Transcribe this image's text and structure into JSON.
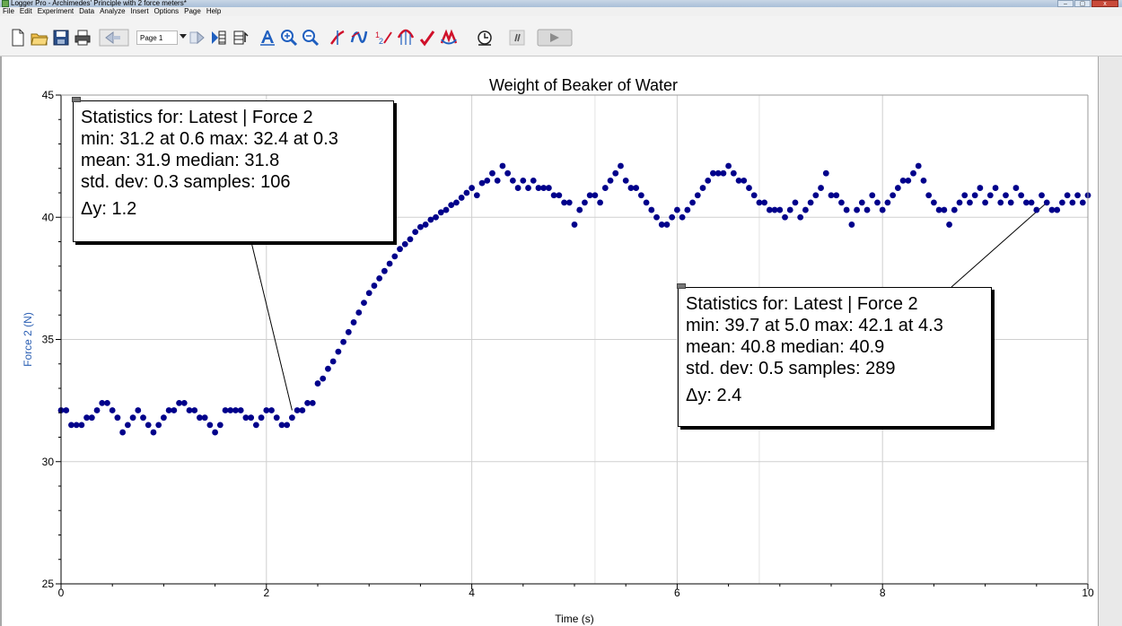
{
  "window": {
    "title": "Logger Pro - Archimedes' Principle with 2 force meters*",
    "buttons": [
      "–",
      "▢",
      "x"
    ]
  },
  "menu": [
    "File",
    "Edit",
    "Experiment",
    "Data",
    "Analyze",
    "Insert",
    "Options",
    "Page",
    "Help"
  ],
  "toolbar": {
    "page_select": "Page 1"
  },
  "colors": {
    "data": "#00008b",
    "accent_blue": "#2b5fb3",
    "red_tool": "#d0102a"
  },
  "icons": [
    "new-file-icon",
    "open-folder-icon",
    "save-icon",
    "print-icon",
    "page-back-icon",
    "page-forward-icon",
    "data-browser-icon",
    "meter-icon",
    "autoscale-icon",
    "zoom-in-icon",
    "zoom-out-icon",
    "examine-icon",
    "tangent-icon",
    "interpolate-icon",
    "statistics-icon",
    "integral-icon",
    "linear-fit-icon",
    "curve-fit-icon",
    "replay-icon",
    "sensor-icon",
    "collect-icon"
  ],
  "chart_data": {
    "type": "scatter",
    "title": "Weight of Beaker of Water",
    "xlabel": "Time (s)",
    "ylabel": "Force 2 (N)",
    "xlim": [
      0,
      10
    ],
    "ylim": [
      25,
      45
    ],
    "x_ticks": [
      0,
      2,
      4,
      6,
      8,
      10
    ],
    "y_ticks": [
      25,
      30,
      35,
      40,
      45
    ],
    "grid": true,
    "series": [
      {
        "points": [
          [
            0.0,
            32.1
          ],
          [
            0.05,
            32.1
          ],
          [
            0.1,
            31.5
          ],
          [
            0.15,
            31.5
          ],
          [
            0.2,
            31.5
          ],
          [
            0.25,
            31.8
          ],
          [
            0.3,
            31.8
          ],
          [
            0.35,
            32.1
          ],
          [
            0.4,
            32.4
          ],
          [
            0.45,
            32.4
          ],
          [
            0.5,
            32.1
          ],
          [
            0.55,
            31.8
          ],
          [
            0.6,
            31.2
          ],
          [
            0.65,
            31.5
          ],
          [
            0.7,
            31.8
          ],
          [
            0.75,
            32.1
          ],
          [
            0.8,
            31.8
          ],
          [
            0.85,
            31.5
          ],
          [
            0.9,
            31.2
          ],
          [
            0.95,
            31.5
          ],
          [
            1.0,
            31.8
          ],
          [
            1.05,
            32.1
          ],
          [
            1.1,
            32.1
          ],
          [
            1.15,
            32.4
          ],
          [
            1.2,
            32.4
          ],
          [
            1.25,
            32.1
          ],
          [
            1.3,
            32.1
          ],
          [
            1.35,
            31.8
          ],
          [
            1.4,
            31.8
          ],
          [
            1.45,
            31.5
          ],
          [
            1.5,
            31.2
          ],
          [
            1.55,
            31.5
          ],
          [
            1.6,
            32.1
          ],
          [
            1.65,
            32.1
          ],
          [
            1.7,
            32.1
          ],
          [
            1.75,
            32.1
          ],
          [
            1.8,
            31.8
          ],
          [
            1.85,
            31.8
          ],
          [
            1.9,
            31.5
          ],
          [
            1.95,
            31.8
          ],
          [
            2.0,
            32.1
          ],
          [
            2.05,
            32.1
          ],
          [
            2.1,
            31.8
          ],
          [
            2.15,
            31.5
          ],
          [
            2.2,
            31.5
          ],
          [
            2.25,
            31.8
          ],
          [
            2.3,
            32.1
          ],
          [
            2.35,
            32.1
          ],
          [
            2.4,
            32.4
          ],
          [
            2.45,
            32.4
          ],
          [
            2.5,
            33.2
          ],
          [
            2.55,
            33.4
          ],
          [
            2.6,
            33.8
          ],
          [
            2.65,
            34.1
          ],
          [
            2.7,
            34.5
          ],
          [
            2.75,
            34.9
          ],
          [
            2.8,
            35.3
          ],
          [
            2.85,
            35.7
          ],
          [
            2.9,
            36.1
          ],
          [
            2.95,
            36.5
          ],
          [
            3.0,
            36.9
          ],
          [
            3.05,
            37.2
          ],
          [
            3.1,
            37.5
          ],
          [
            3.15,
            37.8
          ],
          [
            3.2,
            38.1
          ],
          [
            3.25,
            38.4
          ],
          [
            3.3,
            38.7
          ],
          [
            3.35,
            38.9
          ],
          [
            3.4,
            39.1
          ],
          [
            3.45,
            39.4
          ],
          [
            3.5,
            39.6
          ],
          [
            3.55,
            39.7
          ],
          [
            3.6,
            39.9
          ],
          [
            3.65,
            40.0
          ],
          [
            3.7,
            40.2
          ],
          [
            3.75,
            40.3
          ],
          [
            3.8,
            40.5
          ],
          [
            3.85,
            40.6
          ],
          [
            3.9,
            40.8
          ],
          [
            3.95,
            41.0
          ],
          [
            4.0,
            41.2
          ],
          [
            4.05,
            40.9
          ],
          [
            4.1,
            41.4
          ],
          [
            4.15,
            41.5
          ],
          [
            4.2,
            41.8
          ],
          [
            4.25,
            41.5
          ],
          [
            4.3,
            42.1
          ],
          [
            4.35,
            41.8
          ],
          [
            4.4,
            41.5
          ],
          [
            4.45,
            41.2
          ],
          [
            4.5,
            41.5
          ],
          [
            4.55,
            41.2
          ],
          [
            4.6,
            41.5
          ],
          [
            4.65,
            41.2
          ],
          [
            4.7,
            41.2
          ],
          [
            4.75,
            41.2
          ],
          [
            4.8,
            40.9
          ],
          [
            4.85,
            40.9
          ],
          [
            4.9,
            40.6
          ],
          [
            4.95,
            40.6
          ],
          [
            5.0,
            39.7
          ],
          [
            5.05,
            40.3
          ],
          [
            5.1,
            40.6
          ],
          [
            5.15,
            40.9
          ],
          [
            5.2,
            40.9
          ],
          [
            5.25,
            40.6
          ],
          [
            5.3,
            41.2
          ],
          [
            5.35,
            41.5
          ],
          [
            5.4,
            41.8
          ],
          [
            5.45,
            42.1
          ],
          [
            5.5,
            41.5
          ],
          [
            5.55,
            41.2
          ],
          [
            5.6,
            41.2
          ],
          [
            5.65,
            40.9
          ],
          [
            5.7,
            40.6
          ],
          [
            5.75,
            40.3
          ],
          [
            5.8,
            40.0
          ],
          [
            5.85,
            39.7
          ],
          [
            5.9,
            39.7
          ],
          [
            5.95,
            40.0
          ],
          [
            6.0,
            40.3
          ],
          [
            6.05,
            40.0
          ],
          [
            6.1,
            40.3
          ],
          [
            6.15,
            40.6
          ],
          [
            6.2,
            40.9
          ],
          [
            6.25,
            41.2
          ],
          [
            6.3,
            41.5
          ],
          [
            6.35,
            41.8
          ],
          [
            6.4,
            41.8
          ],
          [
            6.45,
            41.8
          ],
          [
            6.5,
            42.1
          ],
          [
            6.55,
            41.8
          ],
          [
            6.6,
            41.5
          ],
          [
            6.65,
            41.5
          ],
          [
            6.7,
            41.2
          ],
          [
            6.75,
            40.9
          ],
          [
            6.8,
            40.6
          ],
          [
            6.85,
            40.6
          ],
          [
            6.9,
            40.3
          ],
          [
            6.95,
            40.3
          ],
          [
            7.0,
            40.3
          ],
          [
            7.05,
            40.0
          ],
          [
            7.1,
            40.3
          ],
          [
            7.15,
            40.6
          ],
          [
            7.2,
            40.0
          ],
          [
            7.25,
            40.3
          ],
          [
            7.3,
            40.6
          ],
          [
            7.35,
            40.9
          ],
          [
            7.4,
            41.2
          ],
          [
            7.45,
            41.8
          ],
          [
            7.5,
            40.9
          ],
          [
            7.55,
            40.9
          ],
          [
            7.6,
            40.6
          ],
          [
            7.65,
            40.3
          ],
          [
            7.7,
            39.7
          ],
          [
            7.75,
            40.3
          ],
          [
            7.8,
            40.6
          ],
          [
            7.85,
            40.3
          ],
          [
            7.9,
            40.9
          ],
          [
            7.95,
            40.6
          ],
          [
            8.0,
            40.3
          ],
          [
            8.05,
            40.6
          ],
          [
            8.1,
            40.9
          ],
          [
            8.15,
            41.2
          ],
          [
            8.2,
            41.5
          ],
          [
            8.25,
            41.5
          ],
          [
            8.3,
            41.8
          ],
          [
            8.35,
            42.1
          ],
          [
            8.4,
            41.5
          ],
          [
            8.45,
            40.9
          ],
          [
            8.5,
            40.6
          ],
          [
            8.55,
            40.3
          ],
          [
            8.6,
            40.3
          ],
          [
            8.65,
            39.7
          ],
          [
            8.7,
            40.3
          ],
          [
            8.75,
            40.6
          ],
          [
            8.8,
            40.9
          ],
          [
            8.85,
            40.6
          ],
          [
            8.9,
            40.9
          ],
          [
            8.95,
            41.2
          ],
          [
            9.0,
            40.6
          ],
          [
            9.05,
            40.9
          ],
          [
            9.1,
            41.2
          ],
          [
            9.15,
            40.6
          ],
          [
            9.2,
            40.9
          ],
          [
            9.25,
            40.6
          ],
          [
            9.3,
            41.2
          ],
          [
            9.35,
            40.9
          ],
          [
            9.4,
            40.6
          ],
          [
            9.45,
            40.6
          ],
          [
            9.5,
            40.3
          ],
          [
            9.55,
            40.9
          ],
          [
            9.6,
            40.6
          ],
          [
            9.65,
            40.3
          ],
          [
            9.7,
            40.3
          ],
          [
            9.75,
            40.6
          ],
          [
            9.8,
            40.9
          ],
          [
            9.85,
            40.6
          ],
          [
            9.9,
            40.9
          ],
          [
            9.95,
            40.6
          ],
          [
            10.0,
            40.9
          ]
        ]
      }
    ]
  },
  "stats": [
    {
      "header": "Statistics for: Latest | Force 2",
      "minmax": "min: 31.2 at 0.6 max: 32.4 at 0.3",
      "mean": "mean: 31.9 median: 31.8",
      "std": "std. dev: 0.3 samples: 106",
      "delta": "Δy: 1.2"
    },
    {
      "header": "Statistics for: Latest | Force 2",
      "minmax": "min: 39.7 at 5.0 max: 42.1 at 4.3",
      "mean": "mean: 40.8 median: 40.9",
      "std": "std. dev: 0.5 samples: 289",
      "delta": "Δy: 2.4"
    }
  ]
}
